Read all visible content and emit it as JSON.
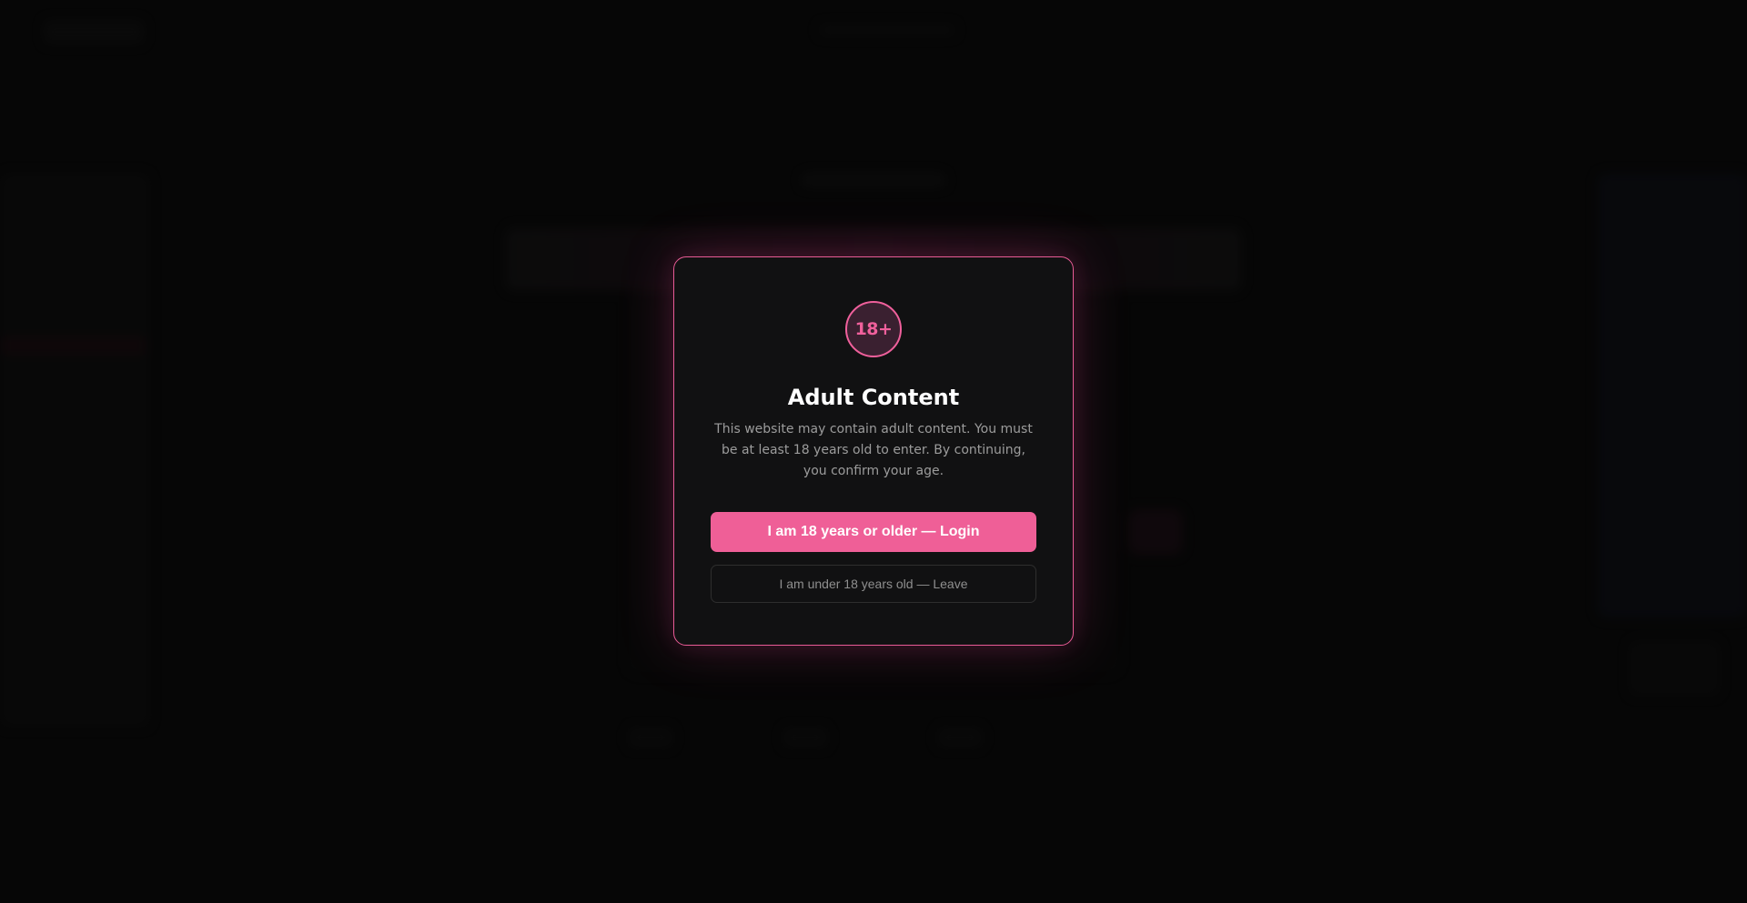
{
  "modal": {
    "badge_text": "18+",
    "title": "Adult Content",
    "description": "This website may contain adult content. You must be at least 18 years old to enter. By continuing, you confirm your age.",
    "confirm_button_label": "I am 18 years or older — Login",
    "leave_button_label": "I am under 18 years old — Leave"
  },
  "colors": {
    "accent": "#ef5f97",
    "modal_background": "#111112",
    "page_background": "#0b0b0b"
  }
}
